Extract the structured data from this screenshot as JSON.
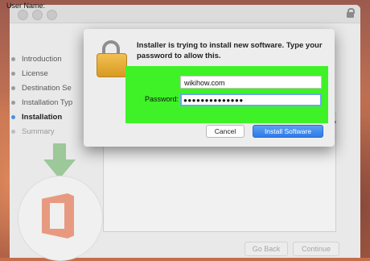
{
  "installer": {
    "steps": [
      {
        "label": "Introduction",
        "state": "done"
      },
      {
        "label": "License",
        "state": "done"
      },
      {
        "label": "Destination Se",
        "state": "done"
      },
      {
        "label": "Installation Typ",
        "state": "done"
      },
      {
        "label": "Installation",
        "state": "active"
      },
      {
        "label": "Summary",
        "state": "pending"
      }
    ],
    "go_back_label": "Go Back",
    "continue_label": "Continue"
  },
  "auth_dialog": {
    "message": "Installer is trying to install new software. Type your password to allow this.",
    "username_label": "User Name:",
    "username_value": "wikihow.com",
    "password_label": "Password:",
    "password_value": "●●●●●●●●●●●●●●",
    "cancel_label": "Cancel",
    "install_label": "Install Software"
  },
  "colors": {
    "highlight": "#3ff227",
    "primary_button": "#2e7ae8",
    "active_step": "#4a90e2"
  },
  "icons": [
    "lock-icon",
    "padlock-icon",
    "download-arrow-icon",
    "office-logo-icon"
  ]
}
